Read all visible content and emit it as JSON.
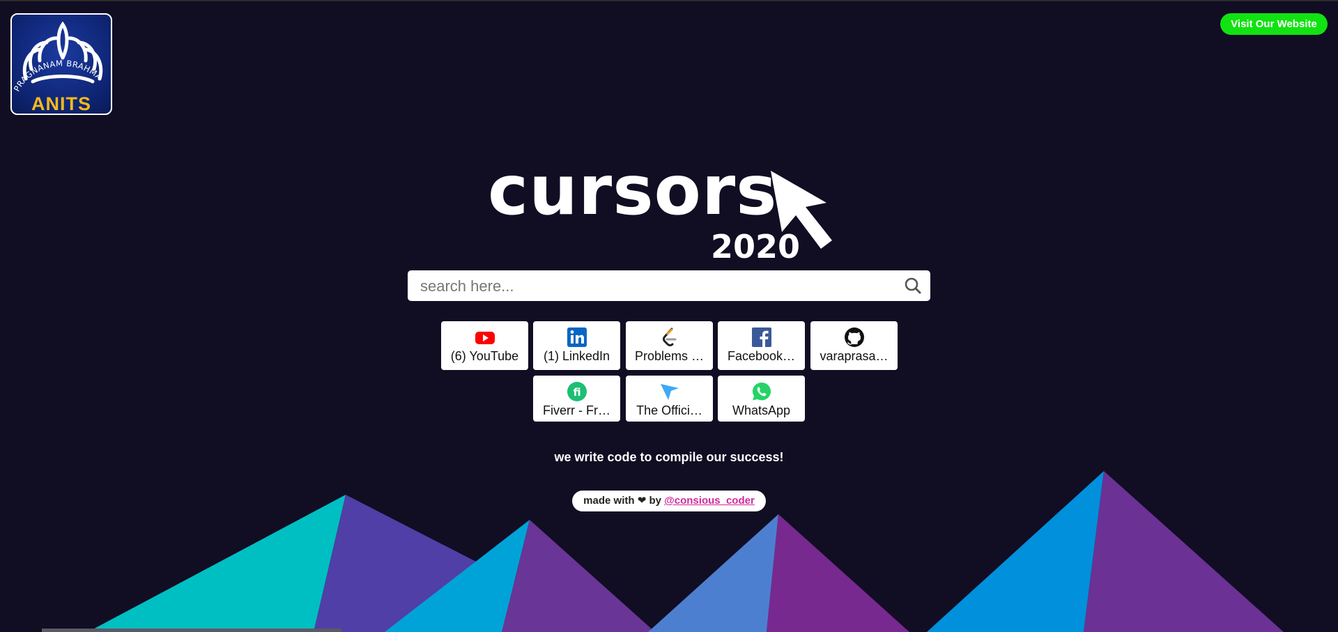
{
  "brand": {
    "motto": "PRAGNANAM BRAHMA",
    "short_name": "ANITS"
  },
  "header": {
    "visit_button": "Visit Our Website"
  },
  "hero": {
    "word": "cursors",
    "year": "2020"
  },
  "search": {
    "placeholder": "search here...",
    "value": ""
  },
  "shortcuts": [
    {
      "label": "(6) YouTube",
      "icon": "youtube-icon"
    },
    {
      "label": "(1) LinkedIn",
      "icon": "linkedin-icon"
    },
    {
      "label": "Problems …",
      "icon": "leetcode-icon"
    },
    {
      "label": "Facebook…",
      "icon": "facebook-icon"
    },
    {
      "label": "varaprasa…",
      "icon": "github-icon"
    },
    {
      "label": "Fiverr - Fr…",
      "icon": "fiverr-icon"
    },
    {
      "label": "The Offici…",
      "icon": "cursor-arrow-icon"
    },
    {
      "label": "WhatsApp",
      "icon": "whatsapp-icon"
    }
  ],
  "tagline": "we write code to compile our success!",
  "credit": {
    "prefix": "made with",
    "by": "by",
    "handle": "@consious_coder"
  },
  "colors": {
    "background": "#110d23",
    "visit_button": "#11e211",
    "credit_link": "#d02a9c",
    "mountain_teal": "#00bfc2",
    "mountain_blue": "#0096d6",
    "mountain_purple": "#6a2e94"
  }
}
